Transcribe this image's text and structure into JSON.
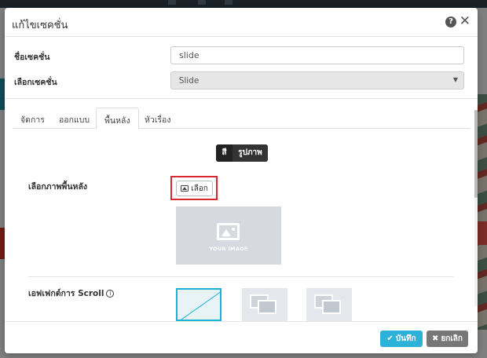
{
  "modal": {
    "title": "แก้ไขเซคชั่น",
    "help_icon": "question-circle-icon",
    "close_icon": "close-icon",
    "help_glyph": "?",
    "close_glyph": "✕"
  },
  "form": {
    "section_name_label": "ชื่อเซคชั่น",
    "section_name_value": "slide",
    "section_select_label": "เลือกเซคชั่น",
    "section_select_value": "Slide"
  },
  "tabs": [
    {
      "label": "จัดการ",
      "active": false
    },
    {
      "label": "ออกแบบ",
      "active": false
    },
    {
      "label": "พื้นหลัง",
      "active": true
    },
    {
      "label": "หัวเรื่อง",
      "active": false
    }
  ],
  "background_tab": {
    "toggle": {
      "color_label": "สี",
      "image_label": "รูปภาพ"
    },
    "choose_image_label": "เลือกภาพพื้นหลัง",
    "choose_button_label": "เลือก",
    "preview_text": "YOUR IMAGE",
    "scroll_effect_label": "เอฟเฟกต์การ Scroll",
    "info_glyph": "i",
    "effect_options": [
      "none",
      "parallax",
      "fixed"
    ]
  },
  "footer": {
    "save_label": "บันทึก",
    "cancel_label": "ยกเลิก",
    "save_glyph": "✔",
    "cancel_glyph": "✖"
  },
  "colors": {
    "primary": "#2cb2d9",
    "highlight_frame": "#d9262f",
    "cancel": "#777777",
    "selected_border": "#1ab3d6"
  }
}
